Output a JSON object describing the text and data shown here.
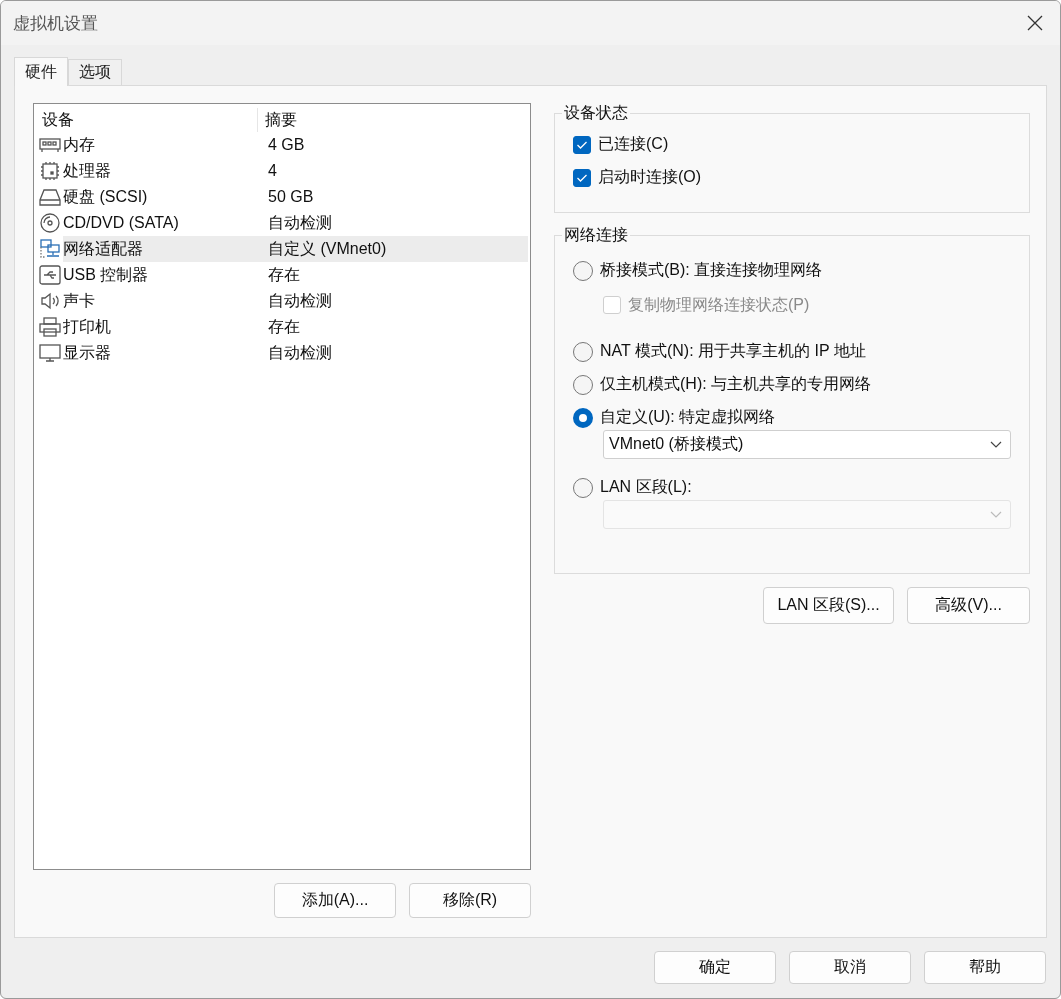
{
  "window": {
    "title": "虚拟机设置"
  },
  "tabs": [
    {
      "label": "硬件",
      "selected": true
    },
    {
      "label": "选项",
      "selected": false
    }
  ],
  "device_table": {
    "columns": [
      "设备",
      "摘要"
    ],
    "rows": [
      {
        "kind": "memory",
        "device": "内存",
        "summary": "4 GB",
        "selected": false
      },
      {
        "kind": "cpu",
        "device": "处理器",
        "summary": "4",
        "selected": false
      },
      {
        "kind": "disk",
        "device": "硬盘 (SCSI)",
        "summary": "50 GB",
        "selected": false
      },
      {
        "kind": "cd",
        "device": "CD/DVD (SATA)",
        "summary": "自动检测",
        "selected": false
      },
      {
        "kind": "network",
        "device": "网络适配器",
        "summary": "自定义 (VMnet0)",
        "selected": true
      },
      {
        "kind": "usb",
        "device": "USB 控制器",
        "summary": "存在",
        "selected": false
      },
      {
        "kind": "sound",
        "device": "声卡",
        "summary": "自动检测",
        "selected": false
      },
      {
        "kind": "printer",
        "device": "打印机",
        "summary": "存在",
        "selected": false
      },
      {
        "kind": "display",
        "device": "显示器",
        "summary": "自动检测",
        "selected": false
      }
    ]
  },
  "device_buttons": [
    "添加(A)...",
    "移除(R)"
  ],
  "device_status": {
    "title": "设备状态",
    "checkboxes": [
      {
        "label": "已连接(C)",
        "checked": true
      },
      {
        "label": "启动时连接(O)",
        "checked": true
      }
    ]
  },
  "network_connection": {
    "title": "网络连接",
    "items": [
      {
        "kind": "radio",
        "label": "桥接模式(B): 直接连接物理网络",
        "selected": false
      },
      {
        "kind": "checkbox",
        "label": "复制物理网络连接状态(P)",
        "checked": false,
        "disabled": true
      },
      {
        "kind": "radio",
        "label": "NAT 模式(N): 用于共享主机的 IP 地址",
        "selected": false
      },
      {
        "kind": "radio",
        "label": "仅主机模式(H): 与主机共享的专用网络",
        "selected": false
      },
      {
        "kind": "radio",
        "label": "自定义(U): 特定虚拟网络",
        "selected": true
      },
      {
        "kind": "select",
        "value": "VMnet0 (桥接模式)",
        "disabled": false
      },
      {
        "kind": "radio",
        "label": "LAN 区段(L):",
        "selected": false
      },
      {
        "kind": "select",
        "disabled": true
      }
    ]
  },
  "network_buttons": [
    "LAN 区段(S)...",
    "高级(V)..."
  ],
  "dialog_buttons": [
    "确定",
    "取消",
    "帮助"
  ]
}
